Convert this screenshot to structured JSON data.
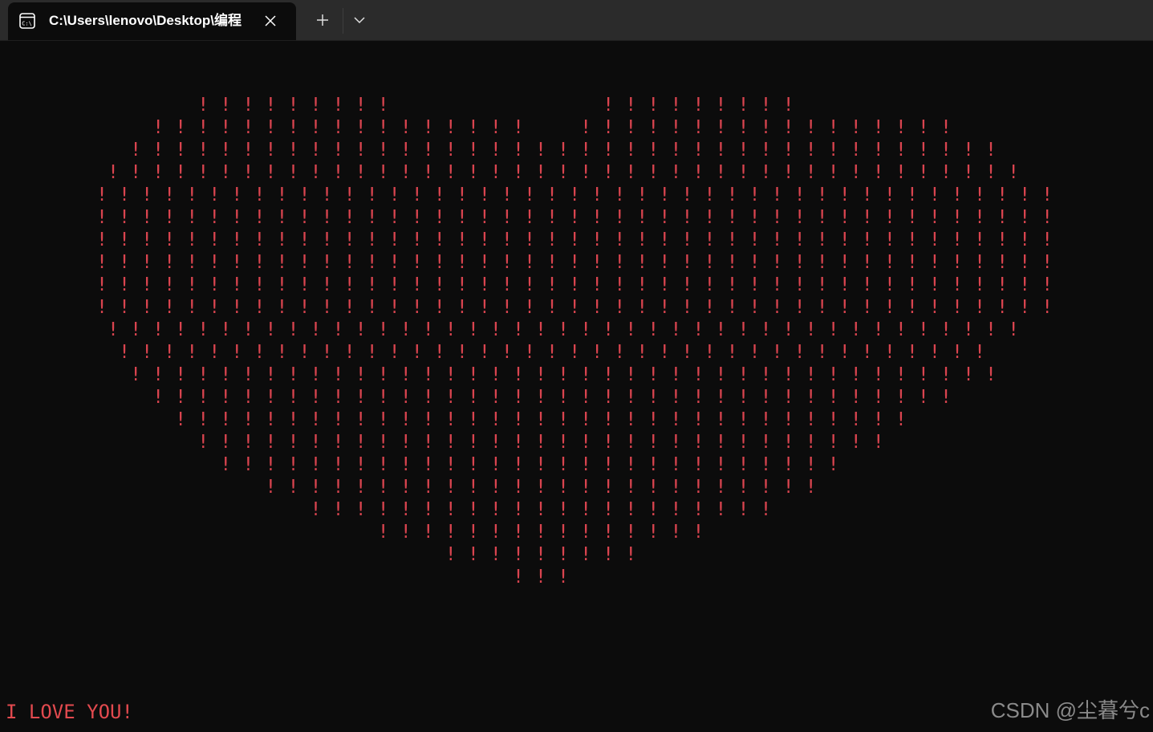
{
  "tab": {
    "title": "C:\\Users\\lenovo\\Desktop\\编程",
    "icon": "terminal-icon",
    "close_icon": "close-icon"
  },
  "toolbar": {
    "new_tab_icon": "plus-icon",
    "dropdown_icon": "chevron-down-icon"
  },
  "terminal": {
    "heart_lines": [
      "         ! ! ! ! ! ! ! ! !                   ! ! ! ! ! ! ! ! !",
      "     ! ! ! ! ! ! ! ! ! ! ! ! ! ! ! ! !     ! ! ! ! ! ! ! ! ! ! ! ! ! ! ! ! !",
      "   ! ! ! ! ! ! ! ! ! ! ! ! ! ! ! ! ! ! ! ! ! ! ! ! ! ! ! ! ! ! ! ! ! ! ! ! ! ! !",
      " ! ! ! ! ! ! ! ! ! ! ! ! ! ! ! ! ! ! ! ! ! ! ! ! ! ! ! ! ! ! ! ! ! ! ! ! ! ! ! ! !",
      "! ! ! ! ! ! ! ! ! ! ! ! ! ! ! ! ! ! ! ! ! ! ! ! ! ! ! ! ! ! ! ! ! ! ! ! ! ! ! ! ! ! !",
      "! ! ! ! ! ! ! ! ! ! ! ! ! ! ! ! ! ! ! ! ! ! ! ! ! ! ! ! ! ! ! ! ! ! ! ! ! ! ! ! ! ! !",
      "! ! ! ! ! ! ! ! ! ! ! ! ! ! ! ! ! ! ! ! ! ! ! ! ! ! ! ! ! ! ! ! ! ! ! ! ! ! ! ! ! ! !",
      "! ! ! ! ! ! ! ! ! ! ! ! ! ! ! ! ! ! ! ! ! ! ! ! ! ! ! ! ! ! ! ! ! ! ! ! ! ! ! ! ! ! !",
      "! ! ! ! ! ! ! ! ! ! ! ! ! ! ! ! ! ! ! ! ! ! ! ! ! ! ! ! ! ! ! ! ! ! ! ! ! ! ! ! ! ! !",
      "! ! ! ! ! ! ! ! ! ! ! ! ! ! ! ! ! ! ! ! ! ! ! ! ! ! ! ! ! ! ! ! ! ! ! ! ! ! ! ! ! ! !",
      " ! ! ! ! ! ! ! ! ! ! ! ! ! ! ! ! ! ! ! ! ! ! ! ! ! ! ! ! ! ! ! ! ! ! ! ! ! ! ! ! !",
      "  ! ! ! ! ! ! ! ! ! ! ! ! ! ! ! ! ! ! ! ! ! ! ! ! ! ! ! ! ! ! ! ! ! ! ! ! ! ! !",
      "   ! ! ! ! ! ! ! ! ! ! ! ! ! ! ! ! ! ! ! ! ! ! ! ! ! ! ! ! ! ! ! ! ! ! ! ! ! ! !",
      "     ! ! ! ! ! ! ! ! ! ! ! ! ! ! ! ! ! ! ! ! ! ! ! ! ! ! ! ! ! ! ! ! ! ! ! !",
      "       ! ! ! ! ! ! ! ! ! ! ! ! ! ! ! ! ! ! ! ! ! ! ! ! ! ! ! ! ! ! ! ! !",
      "         ! ! ! ! ! ! ! ! ! ! ! ! ! ! ! ! ! ! ! ! ! ! ! ! ! ! ! ! ! ! !",
      "           ! ! ! ! ! ! ! ! ! ! ! ! ! ! ! ! ! ! ! ! ! ! ! ! ! ! ! !",
      "               ! ! ! ! ! ! ! ! ! ! ! ! ! ! ! ! ! ! ! ! ! ! ! ! !",
      "                   ! ! ! ! ! ! ! ! ! ! ! ! ! ! ! ! ! ! ! ! !",
      "                         ! ! ! ! ! ! ! ! ! ! ! ! ! ! !",
      "                               ! ! ! ! ! ! ! ! !",
      "                                     ! ! !"
    ],
    "message": "I LOVE YOU!",
    "text_color": "#d9444f"
  },
  "watermark": "CSDN @尘暮兮c"
}
